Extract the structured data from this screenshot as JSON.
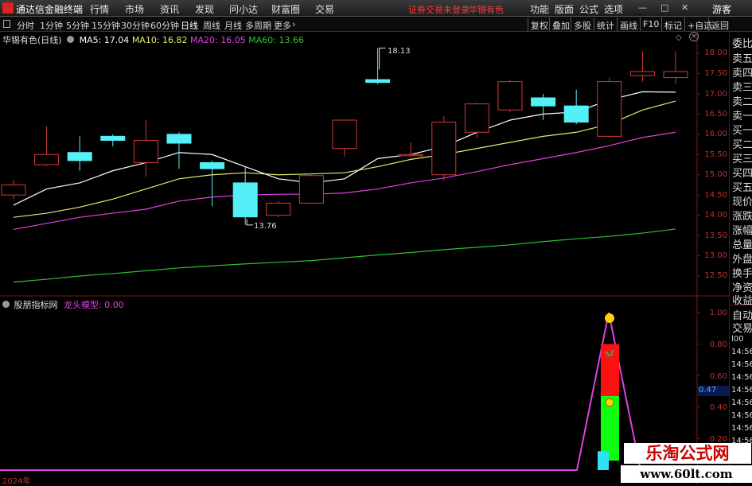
{
  "app": {
    "title": "通达信金融终端",
    "menu": [
      "行情",
      "市场",
      "资讯",
      "发现",
      "问小达",
      "财富圈",
      "交易"
    ],
    "status_red": "证券交易未登录",
    "stock_name": "华锡有色",
    "right_menu": [
      "功能",
      "版面",
      "公式",
      "选项"
    ],
    "guest": "游客"
  },
  "tabs": {
    "items": [
      "分时",
      "1分钟",
      "5分钟",
      "15分钟",
      "30分钟",
      "60分钟",
      "日线",
      "周线",
      "月线",
      "多周期",
      "更多"
    ],
    "active": "日线",
    "right_buttons": [
      "复权",
      "叠加",
      "多股",
      "统计",
      "画线",
      "F10",
      "标记",
      "+自选",
      "返回"
    ]
  },
  "main_legend": {
    "title": "华锡有色(日线)",
    "ma5": "MA5: 17.04",
    "ma10": "MA10: 16.82",
    "ma20": "MA20: 16.05",
    "ma60": "MA60: 13.66"
  },
  "colors": {
    "ma5": "#ffffff",
    "ma10": "#e8e870",
    "ma20": "#e040e0",
    "ma60": "#30c030",
    "up": "#d23a3a",
    "down": "#54f0f8",
    "axis": "#c03030"
  },
  "price_axis": [
    "18.00",
    "17.50",
    "17.00",
    "16.50",
    "16.00",
    "15.50",
    "15.00",
    "14.50",
    "14.00",
    "13.50",
    "13.00",
    "12.50"
  ],
  "price_annotations": {
    "high": "18.13",
    "low": "13.76"
  },
  "candles": [
    {
      "o": 14.5,
      "c": 14.75,
      "h": 14.88,
      "l": 14.4
    },
    {
      "o": 15.25,
      "c": 15.5,
      "h": 16.2,
      "l": 15.22
    },
    {
      "o": 15.55,
      "c": 15.35,
      "h": 15.95,
      "l": 15.1
    },
    {
      "o": 15.95,
      "c": 15.85,
      "h": 16.0,
      "l": 15.7
    },
    {
      "o": 15.3,
      "c": 15.85,
      "h": 16.35,
      "l": 14.95
    },
    {
      "o": 16.0,
      "c": 15.78,
      "h": 16.05,
      "l": 15.15
    },
    {
      "o": 15.3,
      "c": 15.15,
      "h": 15.35,
      "l": 14.22
    },
    {
      "o": 14.8,
      "c": 13.96,
      "h": 15.2,
      "l": 13.76
    },
    {
      "o": 14.0,
      "c": 14.3,
      "h": 14.35,
      "l": 13.95
    },
    {
      "o": 14.3,
      "c": 14.98,
      "h": 15.05,
      "l": 14.3
    },
    {
      "o": 15.65,
      "c": 16.35,
      "h": 16.35,
      "l": 15.45
    },
    {
      "o": 17.35,
      "c": 17.28,
      "h": 18.13,
      "l": 17.24
    },
    {
      "o": 15.5,
      "c": 15.5,
      "h": 15.8,
      "l": 15.45
    },
    {
      "o": 15.0,
      "c": 16.3,
      "h": 16.45,
      "l": 14.85
    },
    {
      "o": 16.05,
      "c": 16.75,
      "h": 16.78,
      "l": 15.9
    },
    {
      "o": 16.6,
      "c": 17.3,
      "h": 17.35,
      "l": 16.55
    },
    {
      "o": 16.9,
      "c": 16.7,
      "h": 17.0,
      "l": 16.35
    },
    {
      "o": 16.7,
      "c": 16.3,
      "h": 17.1,
      "l": 16.25
    },
    {
      "o": 15.95,
      "c": 17.3,
      "h": 17.4,
      "l": 15.92
    },
    {
      "o": 17.45,
      "c": 17.55,
      "h": 18.05,
      "l": 17.3
    },
    {
      "o": 17.4,
      "c": 17.55,
      "h": 18.05,
      "l": 17.25
    }
  ],
  "ma_lines": {
    "ma5": [
      14.25,
      14.65,
      14.8,
      15.1,
      15.3,
      15.55,
      15.5,
      15.2,
      14.9,
      14.8,
      14.9,
      15.4,
      15.5,
      15.7,
      16.05,
      16.35,
      16.5,
      16.55,
      16.85,
      17.05,
      17.04
    ],
    "ma10": [
      13.95,
      14.05,
      14.2,
      14.4,
      14.65,
      14.9,
      15.0,
      15.05,
      15.0,
      15.02,
      15.05,
      15.2,
      15.38,
      15.5,
      15.65,
      15.8,
      15.95,
      16.05,
      16.25,
      16.6,
      16.82
    ],
    "ma20": [
      13.65,
      13.8,
      13.95,
      14.05,
      14.15,
      14.35,
      14.45,
      14.5,
      14.52,
      14.52,
      14.55,
      14.65,
      14.8,
      14.92,
      15.08,
      15.25,
      15.4,
      15.55,
      15.72,
      15.92,
      16.05
    ],
    "ma60": [
      12.35,
      12.42,
      12.5,
      12.56,
      12.63,
      12.7,
      12.75,
      12.8,
      12.84,
      12.88,
      12.95,
      13.02,
      13.08,
      13.15,
      13.21,
      13.27,
      13.35,
      13.42,
      13.48,
      13.56,
      13.66
    ]
  },
  "indicator": {
    "title": "股朋指标网",
    "name": "龙头模型",
    "value": "0.00",
    "axis": [
      "1.00",
      "0.80",
      "0.60",
      "0.40",
      "0.20"
    ],
    "current": "0.47"
  },
  "right_panel": {
    "labels": [
      "委比",
      "卖五",
      "卖四",
      "卖三",
      "卖二",
      "卖一",
      "买一",
      "买二",
      "买三",
      "买四",
      "买五",
      "现价",
      "涨跌",
      "涨幅",
      "总量",
      "外盘",
      "换手",
      "净资",
      "收益"
    ],
    "auto_trade": [
      "自动",
      "交易"
    ],
    "volume_head": "l00",
    "times": [
      "14:56",
      "14:56",
      "14:56",
      "14:56",
      "14:56",
      "14:56",
      "14:56",
      "14:56"
    ]
  },
  "year_label": "2024年",
  "watermark": {
    "line1": "乐淘公式网",
    "line2": "www.60lt.com"
  }
}
